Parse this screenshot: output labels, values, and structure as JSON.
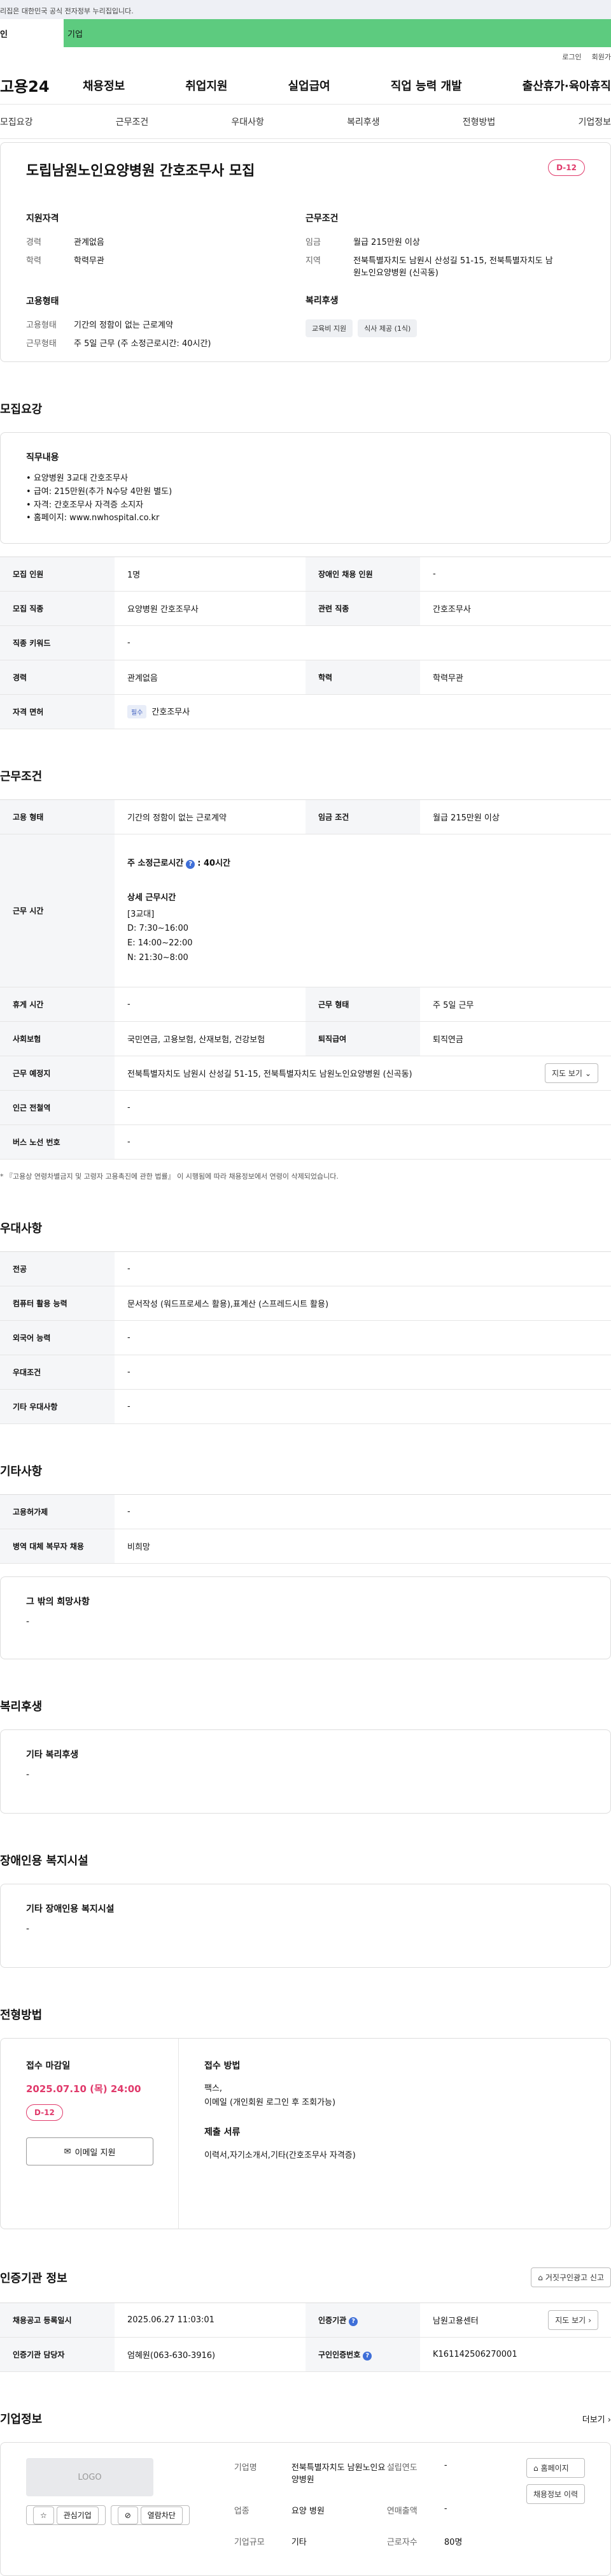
{
  "top": {
    "notice": "리집은 대한민국 공식 전자정부 누리집입니다."
  },
  "tabs": {
    "person": "인",
    "corp": "기업"
  },
  "util": {
    "login": "로그인",
    "join": "회원가"
  },
  "gnb": {
    "logo": "고용24",
    "menu": [
      "채용정보",
      "취업지원",
      "실업급여",
      "직업 능력 개발",
      "출산휴가·육아휴직"
    ]
  },
  "subtabs": [
    "모집요강",
    "근무조건",
    "우대사항",
    "복리후생",
    "전형방법",
    "기업정보"
  ],
  "summary": {
    "title": "도립남원노인요양병원 간호조무사 모집",
    "dday": "D-12",
    "qual_h": "지원자격",
    "career_k": "경력",
    "career_v": "관계없음",
    "edu_k": "학력",
    "edu_v": "학력무관",
    "emp_h": "고용형태",
    "emptype_k": "고용형태",
    "emptype_v": "기간의 정함이 없는 근로계약",
    "worktype_k": "근무형태",
    "worktype_v": "주 5일 근무 (주 소정근로시간: 40시간)",
    "cond_h": "근무조건",
    "wage_k": "임금",
    "wage_v": "월급 215만원 이상",
    "area_k": "지역",
    "area_v": "전북특별자치도 남원시 산성길 51-15, 전북특별자치도 남원노인요양병원 (신곡동)",
    "welfare_h": "복리후생",
    "welfare_tags": [
      "교육비 지원",
      "식사 제공 (1식)"
    ]
  },
  "recruit": {
    "section": "모집요강",
    "duty_h": "직무내용",
    "duty": [
      "요양병원 3교대 간호조무사",
      "급여: 215만원(추가 N수당 4만원 별도)",
      "자격: 간호조무사 자격증 소지자",
      "홈페이지: www.nwhospital.co.kr"
    ],
    "rows": [
      {
        "k1": "모집 인원",
        "v1": "1명",
        "k2": "장애인 채용 인원",
        "v2": "-"
      },
      {
        "k1": "모집 직종",
        "v1": "요양병원 간호조무사",
        "k2": "관련 직종",
        "v2": "간호조무사"
      },
      {
        "k1": "직종 키워드",
        "v1": "-"
      },
      {
        "k1": "경력",
        "v1": "관계없음",
        "k2": "학력",
        "v2": "학력무관"
      }
    ],
    "license_k": "자격 면허",
    "license_badge": "필수",
    "license_v": "간호조무사"
  },
  "work": {
    "section": "근무조건",
    "emp_k": "고용 형태",
    "emp_v": "기간의 정함이 없는 근로계약",
    "wage_k": "임금 조건",
    "wage_v": "월급 215만원 이상",
    "time_k": "근무 시간",
    "time_main": "주 소정근로시간 ? : 40시간",
    "time_main_a": "주 소정근로시간",
    "time_main_b": ": 40시간",
    "time_detail_h": "상세 근무시간",
    "time_detail": [
      "[3교대]",
      "D: 7:30~16:00",
      "E: 14:00~22:00",
      "N: 21:30~8:00"
    ],
    "rest_k": "휴게 시간",
    "rest_v": "-",
    "form_k": "근무 형태",
    "form_v": "주 5일 근무",
    "ins_k": "사회보험",
    "ins_v": "국민연금, 고용보험, 산재보험, 건강보험",
    "retire_k": "퇴직급여",
    "retire_v": "퇴직연금",
    "loc_k": "근무 예정지",
    "loc_v": "전북특별자치도 남원시 산성길 51-15, 전북특별자치도 남원노인요양병원 (신곡동)",
    "map_btn": "지도 보기",
    "subway_k": "인근 전철역",
    "subway_v": "-",
    "bus_k": "버스 노선 번호",
    "bus_v": "-",
    "note": "* 『고용상 연령차별금지 및 고령자 고용촉진에 관한 법률』 이 시행됨에 따라 채용정보에서 연령이 삭제되었습니다."
  },
  "pref": {
    "section": "우대사항",
    "rows": [
      {
        "k": "전공",
        "v": "-"
      },
      {
        "k": "컴퓨터 활용 능력",
        "v": "문서작성 (워드프로세스 활용),표계산 (스프레드시트 활용)"
      },
      {
        "k": "외국어 능력",
        "v": "-"
      },
      {
        "k": "우대조건",
        "v": "-"
      },
      {
        "k": "기타 우대사항",
        "v": "-"
      }
    ]
  },
  "etc": {
    "section": "기타사항",
    "rows": [
      {
        "k": "고용허가제",
        "v": "-"
      },
      {
        "k": "병역 대체 복무자 채용",
        "v": "비희망"
      }
    ],
    "wish_h": "그 밖의 희망사항",
    "wish_v": "-"
  },
  "welfare": {
    "section": "복리후생",
    "h": "기타 복리후생",
    "v": "-"
  },
  "disabled": {
    "section": "장애인용 복지시설",
    "h": "기타 장애인용 복지시설",
    "v": "-"
  },
  "apply": {
    "section": "전형방법",
    "deadline_h": "접수 마감일",
    "deadline_v": "2025.07.10 (목) 24:00",
    "dday": "D-12",
    "mail_btn": "이메일 지원",
    "method_h": "접수 방법",
    "method_v1": "팩스,",
    "method_v2": "이메일 (개인회원 로그인 후 조회가능)",
    "docs_h": "제출 서류",
    "docs_v": "이력서,자기소개서,기타(간호조무사 자격증)"
  },
  "agency": {
    "section": "인증기관 정보",
    "report_btn": "거짓구인광고 신고",
    "r1k1": "채용공고 등록일시",
    "r1v1": "2025.06.27 11:03:01",
    "r1k2": "인증기관",
    "r1v2": "남원고용센터",
    "map_btn": "지도 보기",
    "r2k1": "인증기관 담당자",
    "r2v1": "엄혜원(063-630-3916)",
    "r2k2": "구인인증번호",
    "r2v2": "K161142506270001"
  },
  "company": {
    "section": "기업정보",
    "more": "더보기",
    "logo": "LOGO",
    "fav_btn": "관심기업",
    "block_btn": "열람차단",
    "name_k": "기업명",
    "name_v": "전북특별자치도 남원노인요양병원",
    "ind_k": "업종",
    "ind_v": "요양 병원",
    "size_k": "기업규모",
    "size_v": "기타",
    "est_k": "설립연도",
    "est_v": "-",
    "sales_k": "연매출액",
    "sales_v": "-",
    "emp_k": "근로자수",
    "emp_v": "80명",
    "home_btn": "홈페이지",
    "list_btn": "채용정보 이력"
  }
}
